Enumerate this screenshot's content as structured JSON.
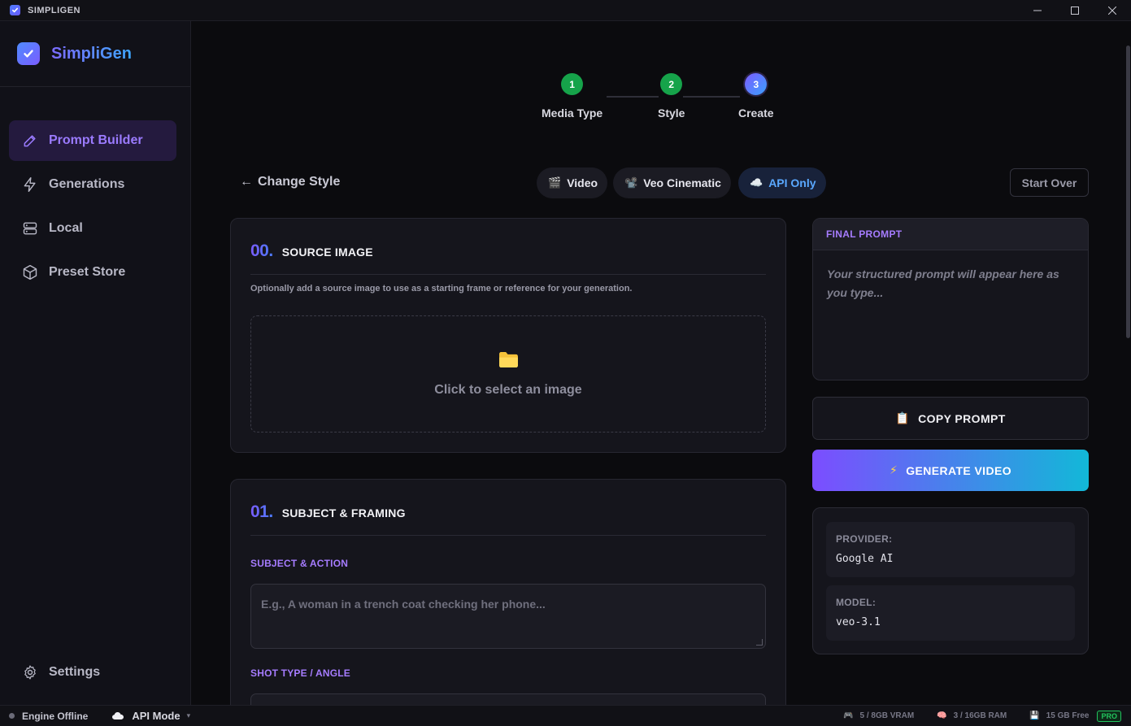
{
  "window": {
    "title": "SIMPLIGEN"
  },
  "brand": {
    "name": "SimpliGen"
  },
  "nav": {
    "items": [
      {
        "label": "Prompt Builder",
        "icon": "pen-icon"
      },
      {
        "label": "Generations",
        "icon": "bolt-icon"
      },
      {
        "label": "Local",
        "icon": "server-icon"
      },
      {
        "label": "Preset Store",
        "icon": "box-icon"
      }
    ],
    "settings": "Settings"
  },
  "stepper": {
    "steps": [
      {
        "num": "1",
        "label": "Media Type",
        "state": "done"
      },
      {
        "num": "2",
        "label": "Style",
        "state": "done"
      },
      {
        "num": "3",
        "label": "Create",
        "state": "current"
      }
    ]
  },
  "toolbar": {
    "back": "Change Style",
    "chips": [
      {
        "icon": "🎬",
        "label": "Video"
      },
      {
        "icon": "📽️",
        "label": "Veo Cinematic"
      },
      {
        "icon": "☁️",
        "label": "API Only"
      }
    ],
    "start_over": "Start Over"
  },
  "source_image": {
    "num": "00.",
    "title": "SOURCE IMAGE",
    "desc": "Optionally add a source image to use as a starting frame or reference for your generation.",
    "dropzone": "Click to select an image"
  },
  "subject": {
    "num": "01.",
    "title": "SUBJECT & FRAMING",
    "action_label": "SUBJECT & ACTION",
    "action_placeholder": "E.g., A woman in a trench coat checking her phone...",
    "shot_label": "SHOT TYPE / ANGLE"
  },
  "final_prompt": {
    "header": "FINAL PROMPT",
    "placeholder": "Your structured prompt will appear here as you type..."
  },
  "buttons": {
    "copy": "COPY PROMPT",
    "copy_icon": "📋",
    "generate": "GENERATE VIDEO",
    "generate_icon": "⚡"
  },
  "info": {
    "provider_key": "PROVIDER:",
    "provider_val": "Google AI",
    "model_key": "MODEL:",
    "model_val": "veo-3.1"
  },
  "status": {
    "engine": "Engine Offline",
    "mode": "API Mode",
    "vram": "5 / 8GB VRAM",
    "ram": "3 / 16GB RAM",
    "disk": "15 GB Free",
    "badge": "PRO"
  },
  "colors": {
    "accent": "#9b7bff",
    "active_nav_bg": "#241a3e",
    "success": "#16a34a",
    "api_chip": "#5aa8ff"
  }
}
